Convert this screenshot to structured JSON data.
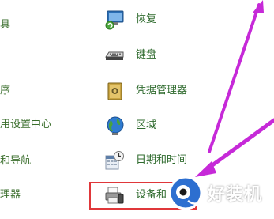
{
  "left_column": {
    "items": [
      {
        "label": "具"
      },
      {
        "label": "序"
      },
      {
        "label": "用设置中心"
      },
      {
        "label": "和导航"
      },
      {
        "label": "理器"
      }
    ]
  },
  "right_column": {
    "items": [
      {
        "label": "恢复",
        "icon": "recovery-icon"
      },
      {
        "label": "键盘",
        "icon": "keyboard-icon"
      },
      {
        "label": "凭据管理器",
        "icon": "credential-manager-icon"
      },
      {
        "label": "区域",
        "icon": "region-globe-icon"
      },
      {
        "label": "日期和时间",
        "icon": "date-time-icon"
      },
      {
        "label": "设备和",
        "icon": "devices-printers-icon"
      }
    ]
  },
  "annotation": {
    "highlight_color": "#e0373a",
    "arrow_color": "#c629d8"
  },
  "watermark": {
    "text": "好装机"
  }
}
